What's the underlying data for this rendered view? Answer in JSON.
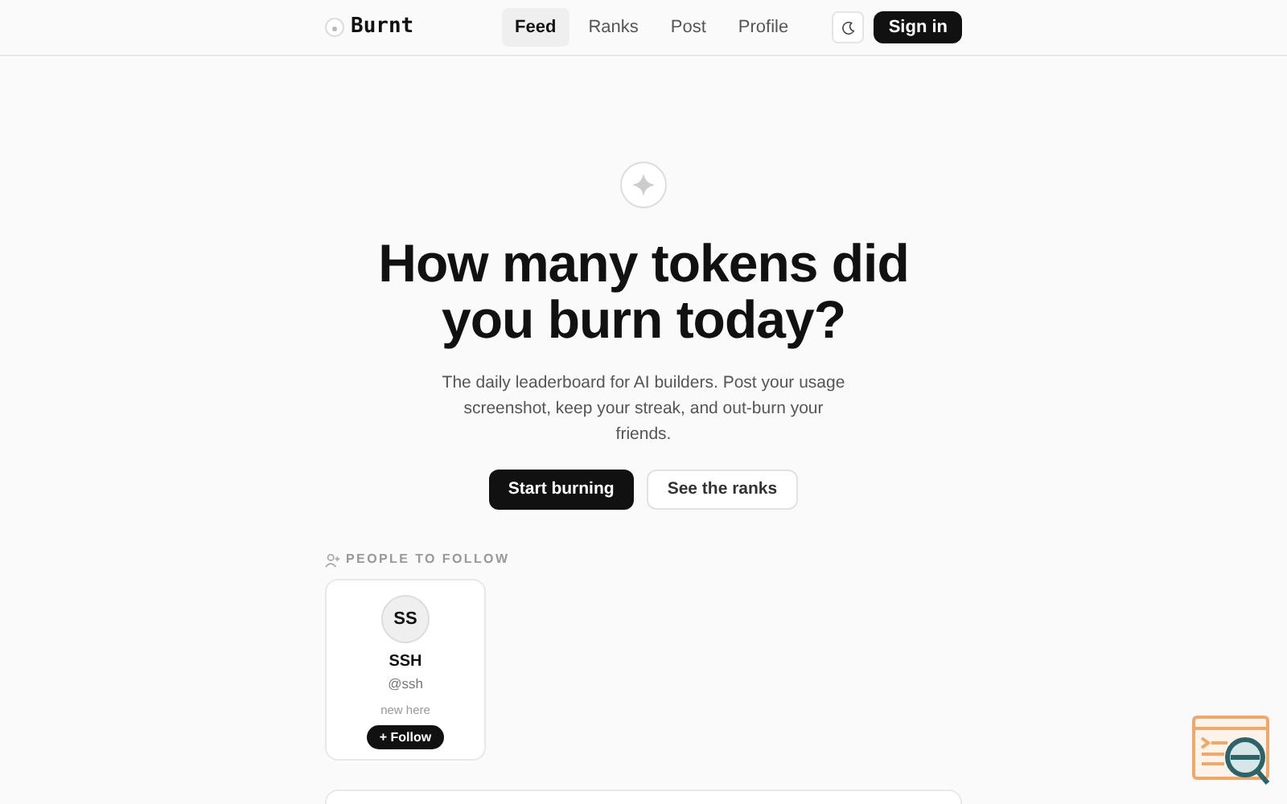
{
  "brand": "Burnt",
  "nav": [
    {
      "label": "Feed",
      "selected": true
    },
    {
      "label": "Ranks",
      "selected": false
    },
    {
      "label": "Post",
      "selected": false
    },
    {
      "label": "Profile",
      "selected": false
    }
  ],
  "sign_in": "Sign in",
  "hero": {
    "title": "How many tokens did you burn today?",
    "subtitle": "The daily leaderboard for AI builders. Post your usage screenshot, keep your streak, and out-burn your friends.",
    "primary": "Start burning",
    "secondary": "See the ranks"
  },
  "people": {
    "heading": "PEOPLE TO FOLLOW",
    "cards": [
      {
        "initials": "SS",
        "name": "SSH",
        "handle": "@ssh",
        "note": "new here",
        "follow": "+ Follow"
      }
    ]
  }
}
